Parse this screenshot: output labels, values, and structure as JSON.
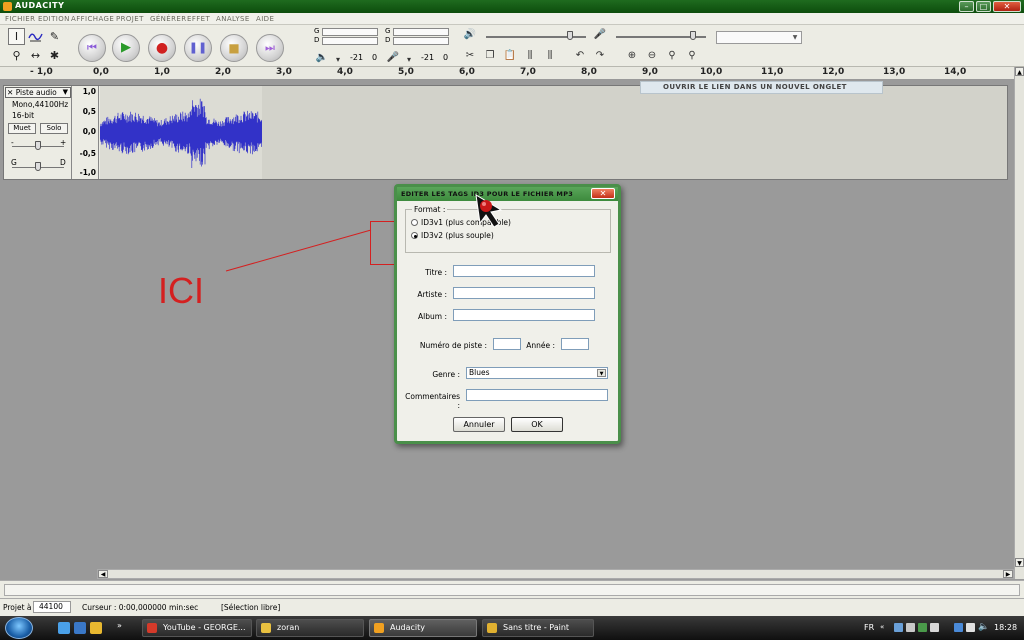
{
  "window": {
    "title": "Audacity",
    "minimize": "–",
    "maximize": "□",
    "close": "✕"
  },
  "menu": [
    "Fichier",
    "Edition",
    "Affichage",
    "Projet",
    "Générer",
    "Effet",
    "Analyse",
    "Aide"
  ],
  "meters": {
    "play": {
      "top": "G",
      "bottom": "D",
      "db1": "-21",
      "db2": "0"
    },
    "record": {
      "top": "G",
      "bottom": "D",
      "db1": "-21",
      "db2": "0"
    }
  },
  "ruler": {
    "ticks": [
      "- 1,0",
      "0,0",
      "1,0",
      "2,0",
      "3,0",
      "4,0",
      "5,0",
      "6,0",
      "7,0",
      "8,0",
      "9,0",
      "10,0",
      "11,0",
      "12,0",
      "13,0",
      "14,0"
    ]
  },
  "track": {
    "name": "Piste audio",
    "format": "Mono,44100Hz",
    "bits": "16-bit",
    "mute": "Muet",
    "solo": "Solo",
    "gain_minus": "-",
    "gain_plus": "+",
    "pan_left": "G",
    "pan_right": "D",
    "scale": [
      "1,0",
      "0,5",
      "0,0",
      "-0,5",
      "-1,0"
    ]
  },
  "tooltip": "Ouvrir le lien dans un nouvel onglet",
  "annotation": "ICI",
  "dialog": {
    "title": "Editer les tags ID3 pour le fichier MP3",
    "format_legend": "Format :",
    "id3v1": "ID3v1 (plus compatible)",
    "id3v2": "ID3v2 (plus souple)",
    "selected_format": "id3v2",
    "labels": {
      "title": "Titre :",
      "artist": "Artiste :",
      "album": "Album :",
      "track_no": "Numéro de piste :",
      "year": "Année :",
      "genre": "Genre :",
      "comments": "Commentaires :"
    },
    "values": {
      "title": "",
      "artist": "",
      "album": "",
      "track_no": "",
      "year": "",
      "genre": "Blues",
      "comments": ""
    },
    "cancel": "Annuler",
    "ok": "OK"
  },
  "status": {
    "rate_label": "Projet à",
    "rate_value": "44100",
    "cursor": "Curseur : 0:00,000000 min:sec",
    "mode": "[Sélection libre]"
  },
  "taskbar": {
    "items": [
      {
        "label": "YouTube - GEORGE...",
        "color": "#d43a2a"
      },
      {
        "label": "zoran",
        "color": "#e8c040"
      },
      {
        "label": "Audacity",
        "color": "#f0a020"
      },
      {
        "label": "Sans titre - Paint",
        "color": "#e0b030"
      }
    ],
    "lang": "FR",
    "clock": "18:28"
  },
  "colors": {
    "titlebar": "#1f6b1f",
    "waveform": "#3232c8",
    "annotation": "#d42020",
    "dialog_border": "#4a8f4a"
  }
}
